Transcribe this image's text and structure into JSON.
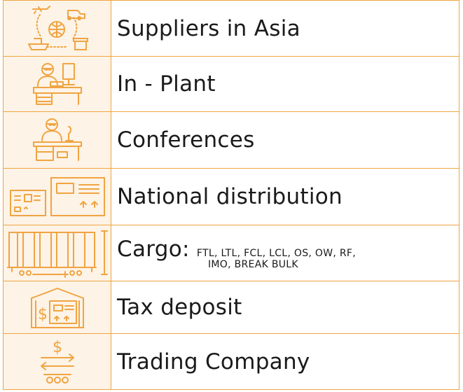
{
  "rows": [
    {
      "icon": "global-logistics-icon",
      "label": "Suppliers in Asia"
    },
    {
      "icon": "worker-desk-icon",
      "label": "In - Plant"
    },
    {
      "icon": "speaker-podium-icon",
      "label": "Conferences"
    },
    {
      "icon": "shipping-boxes-icon",
      "label": "National distribution"
    },
    {
      "icon": "container-railcar-icon",
      "label": "Cargo:",
      "sub_line1": "FTL, LTL, FCL, LCL, OS, OW, RF,",
      "sub_line2": "IMO, BREAK BULK"
    },
    {
      "icon": "warehouse-dollar-icon",
      "label": "Tax deposit"
    },
    {
      "icon": "dollar-exchange-icon",
      "label": "Trading Company"
    }
  ],
  "colors": {
    "accent": "#f0a442",
    "cell_bg": "#fdf3e6",
    "text": "#1a1a1a"
  }
}
